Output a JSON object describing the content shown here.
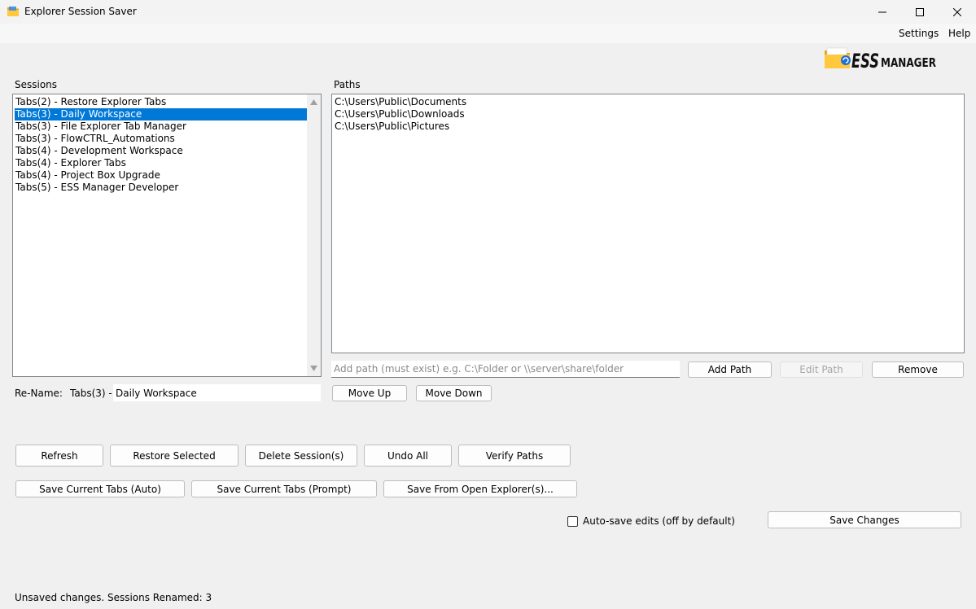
{
  "window": {
    "title": "Explorer Session Saver",
    "controls": {
      "minimize": "minimize-icon",
      "maximize": "maximize-icon",
      "close": "close-icon"
    }
  },
  "menu": {
    "settings": "Settings",
    "help": "Help"
  },
  "logo": {
    "text_ess": "ESS",
    "text_manager": "MANAGER",
    "icon": "folder-icon"
  },
  "sessions": {
    "label": "Sessions",
    "selected_index": 1,
    "items": [
      "Tabs(2) - Restore Explorer Tabs",
      "Tabs(3) - Daily Workspace",
      "Tabs(3) - File Explorer Tab Manager",
      "Tabs(3) - FlowCTRL_Automations",
      "Tabs(4) - Development Workspace",
      "Tabs(4) - Explorer Tabs",
      "Tabs(4) - Project Box Upgrade",
      "Tabs(5) - ESS Manager Developer"
    ]
  },
  "paths": {
    "label": "Paths",
    "items": [
      "C:\\Users\\Public\\Documents",
      "C:\\Users\\Public\\Downloads",
      "C:\\Users\\Public\\Pictures"
    ],
    "input_placeholder": "Add path (must exist) e.g. C:\\Folder or \\\\server\\share\\folder",
    "add_label": "Add Path",
    "edit_label": "Edit Path",
    "remove_label": "Remove",
    "move_up_label": "Move Up",
    "move_down_label": "Move Down"
  },
  "rename": {
    "label": "Re-Name:",
    "prefix": "Tabs(3) -",
    "value": "Daily Workspace"
  },
  "actions": {
    "refresh": "Refresh",
    "restore_selected": "Restore Selected",
    "delete_sessions": "Delete Session(s)",
    "undo_all": "Undo All",
    "verify_paths": "Verify Paths",
    "save_auto": "Save Current Tabs (Auto)",
    "save_prompt": "Save Current Tabs (Prompt)",
    "save_from_explorer": "Save From Open Explorer(s)...",
    "autosave_label": "Auto-save edits (off by default)",
    "autosave_checked": false,
    "save_changes": "Save Changes"
  },
  "status": "Unsaved changes. Sessions Renamed: 3"
}
